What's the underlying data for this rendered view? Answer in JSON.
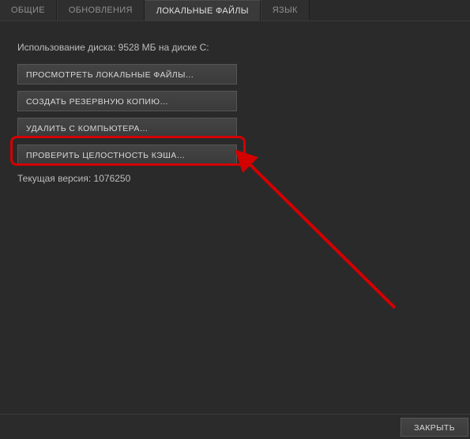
{
  "tabs": {
    "general": {
      "label": "ОБЩИЕ"
    },
    "updates": {
      "label": "ОБНОВЛЕНИЯ"
    },
    "local": {
      "label": "ЛОКАЛЬНЫЕ ФАЙЛЫ"
    },
    "language": {
      "label": "ЯЗЫК"
    },
    "active": "local"
  },
  "disk_usage": "Использование диска: 9528 МБ на диске C:",
  "buttons": {
    "browse": "ПРОСМОТРЕТЬ ЛОКАЛЬНЫЕ ФАЙЛЫ…",
    "backup": "СОЗДАТЬ РЕЗЕРВНУЮ КОПИЮ…",
    "delete": "УДАЛИТЬ С КОМПЬЮТЕРА…",
    "verify": "ПРОВЕРИТЬ ЦЕЛОСТНОСТЬ КЭША…"
  },
  "version": "Текущая версия: 1076250",
  "footer": {
    "close": "ЗАКРЫТЬ"
  },
  "annotation": {
    "highlight_target": "verify",
    "color": "#d40000"
  }
}
